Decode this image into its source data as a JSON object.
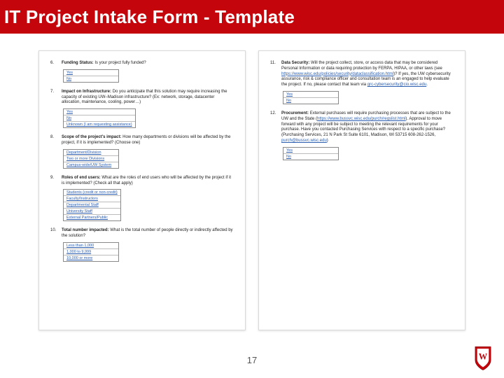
{
  "title": "IT Project Intake Form - Template",
  "pageNumber": "17",
  "left": {
    "q6": {
      "num": "6.",
      "label": "Funding Status:",
      "text": "Is your project fully funded?",
      "opts": [
        "Yes",
        "No"
      ]
    },
    "q7": {
      "num": "7.",
      "label": "Impact on Infrastructure:",
      "text": "Do you anticipate that this solution may require increasing the capacity of existing UW–Madison infrastructure? (Ex: network, storage, datacenter allocation, maintenance, cooling, power…)",
      "opts": [
        "Yes",
        "No",
        "Unknown (I am requesting assistance)"
      ]
    },
    "q8": {
      "num": "8.",
      "label": "Scope of the project's impact:",
      "text": "How many departments or divisions will be affected by the project, if it is implemented? (Choose one)",
      "opts": [
        "Department/Division",
        "Two or more Divisions",
        "Campus-wide/UW System"
      ]
    },
    "q9": {
      "num": "9.",
      "label": "Roles of end users:",
      "text": "What are the roles of end users who will be affected by the project if it is implemented? (Check all that apply)",
      "opts": [
        "Students (credit or non-credit)",
        "Faculty/Instructors",
        "Departmental Staff",
        "University Staff",
        "External Partners/Public"
      ]
    },
    "q10": {
      "num": "10.",
      "label": "Total number impacted:",
      "text": "What is the total number of people directly or indirectly affected by the solution?",
      "opts": [
        "Less than 1,000",
        "1,000 to 9,999",
        "10,000 or more"
      ]
    }
  },
  "right": {
    "q11": {
      "num": "11.",
      "label": "Data Security:",
      "text": "Will the project collect, store, or access data that may be considered Personal Information or data requiring protection by FERPA, HIPAA, or other laws (see ",
      "linkA": "https://www.wisc.edu/policies/security/dataclassification.html",
      "text2": ")? If yes, the UW cybersecurity assurance, risk & compliance officer and consultation team is an engaged to help evaluate the project. If no, please contact that team via ",
      "email": "grc-cybersecurity@cio.wisc.edu",
      "opts": [
        "Yes",
        "No"
      ]
    },
    "q12": {
      "num": "12.",
      "label": "Procurement:",
      "text": "External purchases will require purchasing processes that are subject to the UW and the State (",
      "linkA": "https://www.bussvc.wisc.edu/purch/regslist.html",
      "text2": "). Approval to move forward with any project will be subject to meeting the relevant requirements for your purchase. Have you contacted Purchasing Services with respect to a specific purchase? (Purchasing Services, 21 N Park St Suite 6101, Madison, WI 53715 608-262-1526, ",
      "email": "purch@bussvc.wisc.edu",
      "opts": [
        "Yes",
        "No"
      ]
    }
  }
}
